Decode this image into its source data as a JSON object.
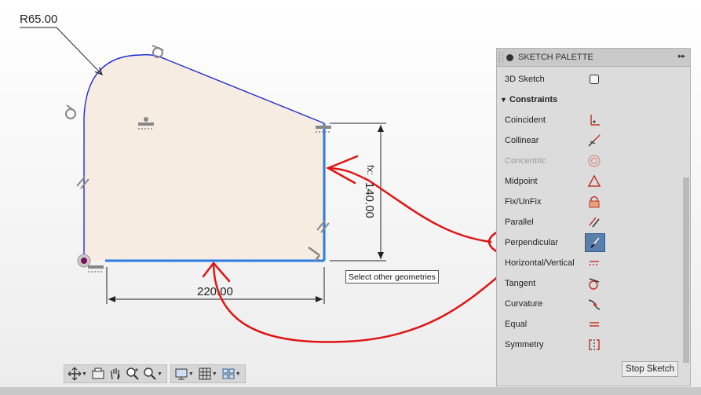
{
  "sketch": {
    "radius_label": "R65.00",
    "width_label": "220.00",
    "height_label": "140.00",
    "height_prefix": "fx:"
  },
  "tooltip": {
    "text": "Select other geometries"
  },
  "palette": {
    "title": "SKETCH PALETTE",
    "expand_glyph": "▸▸",
    "items": [
      {
        "label": "3D Sketch",
        "icon": "checkbox-icon"
      },
      {
        "label": "Constraints",
        "icon": "section-collapse-icon"
      },
      {
        "label": "Coincident",
        "icon": "coincident-icon"
      },
      {
        "label": "Collinear",
        "icon": "collinear-icon"
      },
      {
        "label": "Concentric",
        "icon": "concentric-icon"
      },
      {
        "label": "Midpoint",
        "icon": "midpoint-icon"
      },
      {
        "label": "Fix/UnFix",
        "icon": "lock-icon"
      },
      {
        "label": "Parallel",
        "icon": "parallel-icon"
      },
      {
        "label": "Perpendicular",
        "icon": "perpendicular-icon"
      },
      {
        "label": "Horizontal/Vertical",
        "icon": "horizontal-vertical-icon"
      },
      {
        "label": "Tangent",
        "icon": "tangent-icon"
      },
      {
        "label": "Curvature",
        "icon": "curvature-icon"
      },
      {
        "label": "Equal",
        "icon": "equal-icon"
      },
      {
        "label": "Symmetry",
        "icon": "symmetry-icon"
      }
    ],
    "stop_button": "Stop Sketch"
  },
  "colors": {
    "profile_fill": "#f7ece2",
    "sketch_line": "#1f2fd6",
    "selection": "#2a7be4",
    "annotation": "#e01414",
    "constraint_icon": "#c0392b"
  }
}
